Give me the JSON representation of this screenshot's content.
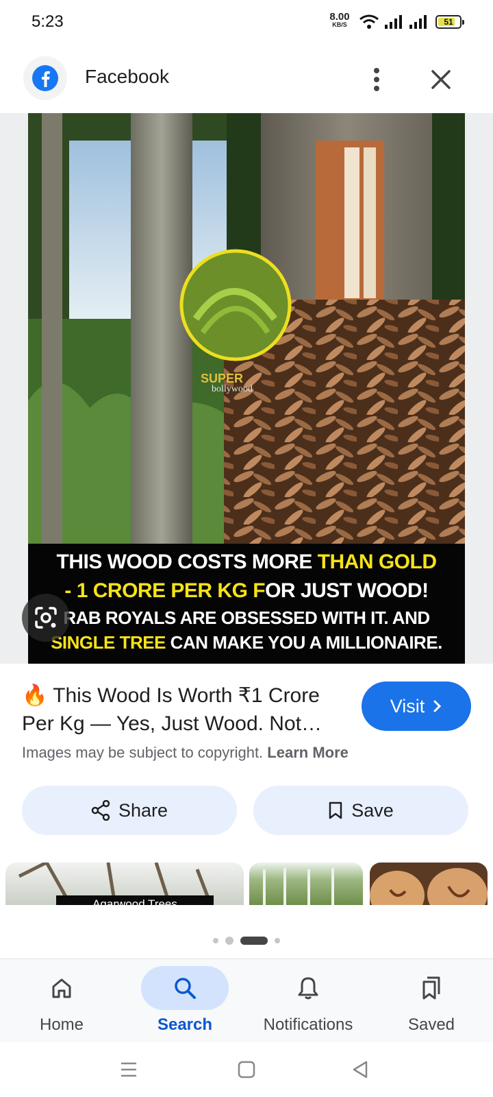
{
  "status_bar": {
    "time": "5:23",
    "net_speed_value": "8.00",
    "net_speed_unit": "KB/S",
    "battery": "51",
    "icons": [
      "wifi-icon",
      "signal-icon",
      "signal-icon",
      "battery-icon"
    ]
  },
  "header": {
    "title": "Facebook",
    "source_icon": "facebook-icon",
    "more_icon": "more-vert-icon",
    "close_icon": "close-icon"
  },
  "image": {
    "watermark_top": "SUPER",
    "watermark_bottom": "bollywood",
    "caption": {
      "line1_white": "THIS WOOD COSTS MORE ",
      "line1_yellow": "THAN GOLD",
      "line2_yellow": "- 1 CRORE PER KG F",
      "line2_white": "OR JUST WOOD!",
      "line3": "RAB ROYALS ARE OBSESSED WITH IT. AND",
      "line4_yellow": "SINGLE TREE ",
      "line4_white": "CAN MAKE YOU A MILLIONAIRE."
    }
  },
  "result": {
    "title": "🔥 This Wood Is Worth ₹1 Crore Per Kg — Yes, Just Wood. Not…",
    "visit_label": "Visit",
    "copyright_text": "Images may be subject to copyright.",
    "learn_more": "Learn More"
  },
  "actions": {
    "share_label": "Share",
    "save_label": "Save"
  },
  "related": {
    "thumb1_caption": "Agarwood Trees"
  },
  "bottom_nav": {
    "items": [
      {
        "label": "Home",
        "icon": "home-icon"
      },
      {
        "label": "Search",
        "icon": "search-icon",
        "active": true
      },
      {
        "label": "Notifications",
        "icon": "bell-icon"
      },
      {
        "label": "Saved",
        "icon": "bookmarks-icon"
      }
    ]
  },
  "colors": {
    "accent": "#1a73e8",
    "pill_bg": "#e8f0fe",
    "nav_active_bg": "#d3e3fd",
    "caption_yellow": "#f6e318"
  }
}
